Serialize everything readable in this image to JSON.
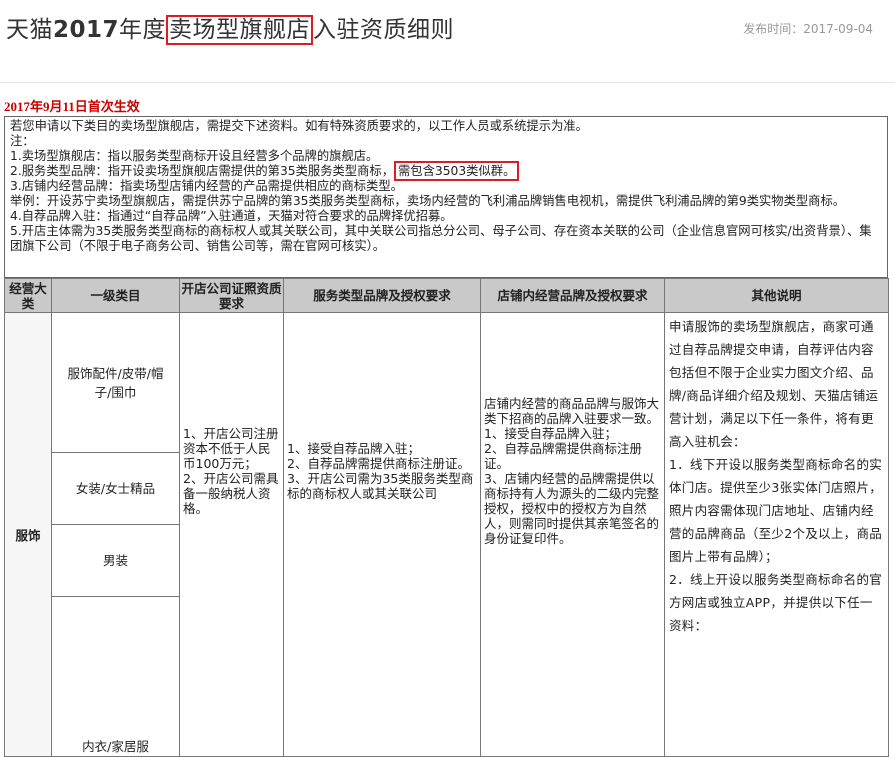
{
  "header": {
    "title_prefix": "天猫",
    "title_year": "2017",
    "title_mid": "年度",
    "title_boxed": "卖场型旗舰店",
    "title_suffix": "入驻资质细则",
    "publish_date": "发布时间：2017-09-04"
  },
  "effective_date": "2017年9月11日首次生效",
  "notes": {
    "intro": "若您申请以下类目的卖场型旗舰店，需提交下述资料。如有特殊资质要求的，以工作人员或系统提示为准。",
    "note_label": "注：",
    "item1": "1.卖场型旗舰店：指以服务类型商标开设且经营多个品牌的旗舰店。",
    "item2_pre": "2.服务类型品牌：指开设卖场型旗舰店需提供的第35类服务类型商标，",
    "item2_boxed": "需包含3503类似群。",
    "item3": "3.店铺内经营品牌：指卖场型店铺内经营的产品需提供相应的商标类型。",
    "example": "举例：开设苏宁卖场型旗舰店，需提供苏宁品牌的第35类服务类型商标，卖场内经营的飞利浦品牌销售电视机，需提供飞利浦品牌的第9类实物类型商标。",
    "item4": "4.自荐品牌入驻：指通过“自荐品牌”入驻通道，天猫对符合要求的品牌择优招募。",
    "item5": "5.开店主体需为35类服务类型商标的商标权人或其关联公司，其中关联公司指总分公司、母子公司、存在资本关联的公司（企业信息官网可核实/出资背景）、集团旗下公司（不限于电子商务公司、销售公司等，需在官网可核实）。"
  },
  "table": {
    "headers": [
      "经营大类",
      "一级类目",
      "开店公司证照资质要求",
      "服务类型品牌及授权要求",
      "店铺内经营品牌及授权要求",
      "其他说明"
    ],
    "category": "服饰",
    "subcategories": [
      "服饰配件/皮带/帽子/围巾",
      "女装/女士精品",
      "男装",
      "内衣/家居服"
    ],
    "company_req": "1、开店公司注册资本不低于人民币100万元；\n2、开店公司需具备一般纳税人资格。",
    "service_brand_req": "1、接受自荐品牌入驻；\n2、自荐品牌需提供商标注册证。\n3、开店公司需为35类服务类型商标的商标权人或其关联公司",
    "store_brand_req": "店铺内经营的商品品牌与服饰大类下招商的品牌入驻要求一致。\n1、接受自荐品牌入驻；\n2、自荐品牌需提供商标注册证。\n3、店铺内经营的品牌需提供以商标持有人为源头的二级内完整授权，授权中的授权方为自然人，则需同时提供其亲笔签名的身份证复印件。",
    "other_notes": "申请服饰的卖场型旗舰店，商家可通过自荐品牌提交申请，自荐评估内容包括但不限于企业实力图文介绍、品牌/商品详细介绍及规划、天猫店铺运营计划，满足以下任一条件，将有更高入驻机会：\n1．线下开设以服务类型商标命名的实体门店。提供至少3张实体门店照片，照片内容需体现门店地址、店铺内经营的品牌商品（至少2个及以上，商品图片上带有品牌）；\n2．线上开设以服务类型商标命名的官方网店或独立APP，并提供以下任一资料："
  },
  "colors": {
    "highlight_border": "#e11b22",
    "effective_text": "#cc0000",
    "header_bg": "#c9c9c9"
  }
}
